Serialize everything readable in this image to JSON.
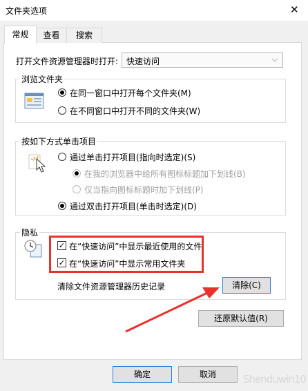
{
  "window": {
    "title": "文件夹选项"
  },
  "tabs": [
    {
      "label": "常规",
      "active": true
    },
    {
      "label": "查看",
      "active": false
    },
    {
      "label": "搜索",
      "active": false
    }
  ],
  "open_explorer": {
    "label": "打开文件资源管理器时打开:",
    "value": "快速访问"
  },
  "browse_folders": {
    "title": "浏览文件夹",
    "options": [
      {
        "label": "在同一窗口中打开每个文件夹(M)",
        "checked": true
      },
      {
        "label": "在不同窗口中打开不同的文件夹(W)",
        "checked": false
      }
    ]
  },
  "click_items": {
    "title": "按如下方式单击项目",
    "single_click": "通过单击打开项目(指向时选定)(S)",
    "sub_options": [
      "在我的浏览器中给所有图标标题加下划线(B)",
      "仅当指向图标标题时加下划线(P)"
    ],
    "double_click": "通过双击打开项目(单击时选定)(D)"
  },
  "privacy": {
    "title": "隐私",
    "checkboxes": [
      {
        "label": "在“快速访问”中显示最近使用的文件",
        "checked": true
      },
      {
        "label": "在“快速访问”中显示常用文件夹",
        "checked": true
      }
    ],
    "clear_history_label": "清除文件资源管理器历史记录",
    "clear_button": "清除(C)"
  },
  "restore_defaults_button": "还原默认值(R)",
  "footer": {
    "ok_button": "确定",
    "cancel_button": "取消"
  },
  "watermark": "Shenduwin10",
  "colors": {
    "annotation_red": "#e8312a",
    "focus_blue": "#2a7fd8"
  }
}
